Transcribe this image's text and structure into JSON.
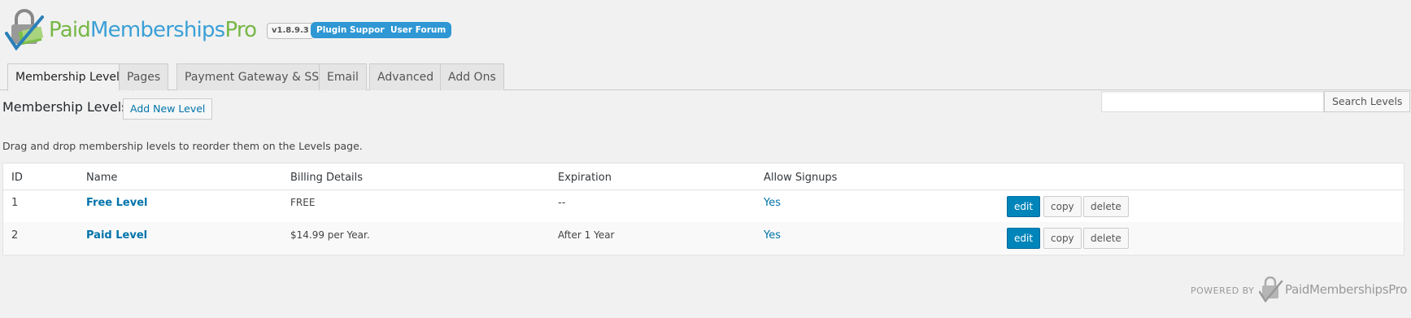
{
  "brand": {
    "name_part1": "Paid",
    "name_part2": "Memberships",
    "name_part3": "Pro",
    "version": "v1.8.9.3",
    "colors": {
      "green": "#76b746",
      "blue": "#3ba0d6",
      "button_blue": "#0085ba",
      "link": "#0073aa"
    }
  },
  "header_links": {
    "support": "Plugin Support",
    "forum": "User Forum"
  },
  "tabs": [
    {
      "label": "Membership Levels",
      "active": true
    },
    {
      "label": "Pages"
    },
    {
      "label": "Payment Gateway & SSL"
    },
    {
      "label": "Email"
    },
    {
      "label": "Advanced"
    },
    {
      "label": "Add Ons"
    }
  ],
  "page": {
    "title": "Membership Levels",
    "add_new_label": "Add New Level",
    "search_placeholder": "",
    "search_button": "Search Levels",
    "help_text": "Drag and drop membership levels to reorder them on the Levels page."
  },
  "table": {
    "columns": [
      "ID",
      "Name",
      "Billing Details",
      "Expiration",
      "Allow Signups"
    ],
    "rows": [
      {
        "id": "1",
        "name": "Free Level",
        "billing": "FREE",
        "expiration": "--",
        "signups": "Yes"
      },
      {
        "id": "2",
        "name": "Paid Level",
        "billing": "$14.99 per Year.",
        "expiration": "After 1 Year",
        "signups": "Yes"
      }
    ],
    "actions": {
      "edit": "edit",
      "copy": "copy",
      "delete": "delete"
    }
  },
  "footer": {
    "powered_by": "POWERED BY",
    "logo_text": "PaidMembershipsPro"
  }
}
